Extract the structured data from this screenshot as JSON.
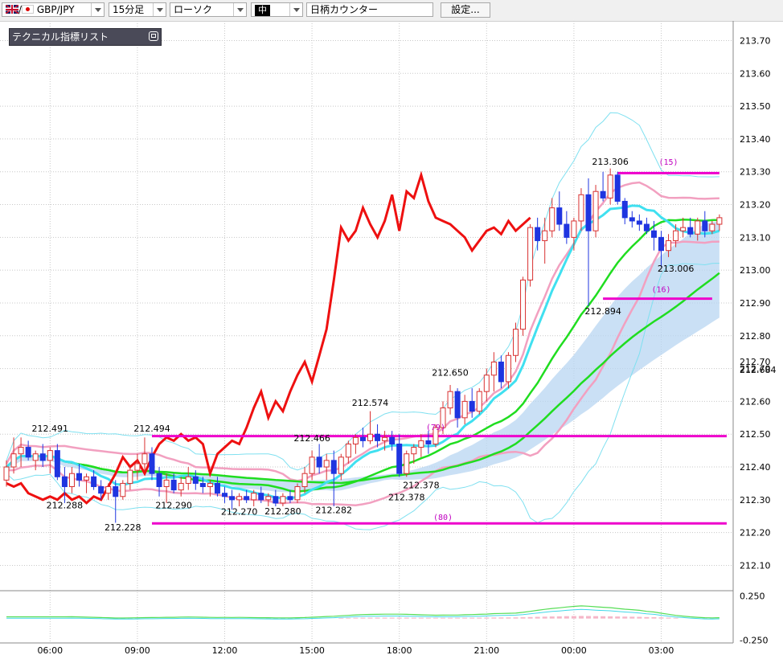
{
  "toolbar": {
    "pair": "GBP/JPY",
    "timeframe": "15分足",
    "chart_type": "ローソク",
    "draw_tool": "中",
    "counter_input": "日柄カウンター",
    "settings_label": "設定..."
  },
  "panel": {
    "title": "テクニカル指標リスト"
  },
  "colors": {
    "candle_up": "#d83030",
    "candle_down": "#1f35e0",
    "bollinger_outer": "#7fe0f0",
    "bollinger_inner": "#f2a0c0",
    "ma_fast": "#40e0f0",
    "ma_mid": "#20dd20",
    "chikou": "#ee1010",
    "lines": "#ee00cc",
    "cloud": "#b8d6f2"
  },
  "chart_data": {
    "type": "candlestick",
    "symbol": "GBP/JPY",
    "timeframe": "15分足",
    "y_ticks": [
      "213.70",
      "213.60",
      "213.50",
      "213.40",
      "213.30",
      "213.20",
      "213.10",
      "213.00",
      "212.90",
      "212.80",
      "212.70",
      "212.60",
      "212.50",
      "212.40",
      "212.30",
      "212.20",
      "212.10"
    ],
    "ylim": [
      212.035,
      213.76
    ],
    "x_labels": [
      {
        "label": "06:00",
        "bar": 6
      },
      {
        "label": "09:00",
        "bar": 18
      },
      {
        "label": "12:00",
        "bar": 30
      },
      {
        "label": "15:00",
        "bar": 42
      },
      {
        "label": "18:00",
        "bar": 54
      },
      {
        "label": "21:00",
        "bar": 66
      },
      {
        "label": "00:00",
        "bar": 78
      },
      {
        "label": "03:00",
        "bar": 90
      }
    ],
    "price_labels": [
      {
        "text": "212.491",
        "bar": 6,
        "value": 212.508
      },
      {
        "text": "212.494",
        "bar": 20,
        "value": 212.508
      },
      {
        "text": "212.288",
        "bar": 8,
        "value": 212.274
      },
      {
        "text": "212.228",
        "bar": 16,
        "value": 212.206
      },
      {
        "text": "212.290",
        "bar": 23,
        "value": 212.274
      },
      {
        "text": "212.270",
        "bar": 32,
        "value": 212.254
      },
      {
        "text": "212.280",
        "bar": 38,
        "value": 212.256
      },
      {
        "text": "212.282",
        "bar": 45,
        "value": 212.259
      },
      {
        "text": "212.466",
        "bar": 42,
        "value": 212.479
      },
      {
        "text": "212.574",
        "bar": 50,
        "value": 212.586
      },
      {
        "text": "212.378",
        "bar": 57,
        "value": 212.335
      },
      {
        "text": "212.378",
        "bar": 55,
        "value": 212.298
      },
      {
        "text": "212.650",
        "bar": 61,
        "value": 212.678
      },
      {
        "text": "213.306",
        "bar": 83,
        "value": 213.321
      },
      {
        "text": "212.894",
        "bar": 82,
        "value": 212.866
      },
      {
        "text": "213.006",
        "bar": 92,
        "value": 212.996
      }
    ],
    "count_labels": [
      {
        "text": "(15)",
        "bar": 91,
        "value": 213.321
      },
      {
        "text": "(16)",
        "bar": 90,
        "value": 212.933
      },
      {
        "text": "(79)",
        "bar": 59,
        "value": 212.513
      },
      {
        "text": "(80)",
        "bar": 60,
        "value": 212.238
      }
    ],
    "right_labels": [
      {
        "text": "212.70",
        "value": 212.721
      },
      {
        "text": "212.684",
        "value": 212.697
      }
    ],
    "hlines": [
      {
        "value": 213.296,
        "bars": [
          84,
          98
        ]
      },
      {
        "value": 212.913,
        "bars": [
          82,
          97
        ]
      },
      {
        "value": 212.494,
        "bars": [
          20,
          99
        ]
      },
      {
        "value": 212.228,
        "bars": [
          20,
          99
        ]
      }
    ],
    "candles": [
      {
        "o": 212.36,
        "h": 212.42,
        "l": 212.34,
        "c": 212.4
      },
      {
        "o": 212.4,
        "h": 212.49,
        "l": 212.38,
        "c": 212.44
      },
      {
        "o": 212.44,
        "h": 212.49,
        "l": 212.4,
        "c": 212.46
      },
      {
        "o": 212.46,
        "h": 212.48,
        "l": 212.42,
        "c": 212.43
      },
      {
        "o": 212.42,
        "h": 212.45,
        "l": 212.39,
        "c": 212.44
      },
      {
        "o": 212.44,
        "h": 212.47,
        "l": 212.4,
        "c": 212.42
      },
      {
        "o": 212.42,
        "h": 212.46,
        "l": 212.38,
        "c": 212.45
      },
      {
        "o": 212.45,
        "h": 212.47,
        "l": 212.36,
        "c": 212.37
      },
      {
        "o": 212.37,
        "h": 212.4,
        "l": 212.29,
        "c": 212.34
      },
      {
        "o": 212.34,
        "h": 212.4,
        "l": 212.32,
        "c": 212.38
      },
      {
        "o": 212.38,
        "h": 212.41,
        "l": 212.34,
        "c": 212.36
      },
      {
        "o": 212.36,
        "h": 212.38,
        "l": 212.32,
        "c": 212.37
      },
      {
        "o": 212.37,
        "h": 212.39,
        "l": 212.33,
        "c": 212.34
      },
      {
        "o": 212.34,
        "h": 212.36,
        "l": 212.3,
        "c": 212.32
      },
      {
        "o": 212.32,
        "h": 212.35,
        "l": 212.3,
        "c": 212.34
      },
      {
        "o": 212.34,
        "h": 212.36,
        "l": 212.23,
        "c": 212.31
      },
      {
        "o": 212.31,
        "h": 212.36,
        "l": 212.3,
        "c": 212.35
      },
      {
        "o": 212.35,
        "h": 212.4,
        "l": 212.33,
        "c": 212.39
      },
      {
        "o": 212.39,
        "h": 212.44,
        "l": 212.36,
        "c": 212.41
      },
      {
        "o": 212.41,
        "h": 212.49,
        "l": 212.39,
        "c": 212.44
      },
      {
        "o": 212.44,
        "h": 212.46,
        "l": 212.36,
        "c": 212.38
      },
      {
        "o": 212.38,
        "h": 212.4,
        "l": 212.31,
        "c": 212.34
      },
      {
        "o": 212.34,
        "h": 212.38,
        "l": 212.29,
        "c": 212.36
      },
      {
        "o": 212.36,
        "h": 212.38,
        "l": 212.32,
        "c": 212.33
      },
      {
        "o": 212.33,
        "h": 212.37,
        "l": 212.31,
        "c": 212.35
      },
      {
        "o": 212.35,
        "h": 212.4,
        "l": 212.33,
        "c": 212.37
      },
      {
        "o": 212.37,
        "h": 212.39,
        "l": 212.33,
        "c": 212.35
      },
      {
        "o": 212.35,
        "h": 212.37,
        "l": 212.32,
        "c": 212.34
      },
      {
        "o": 212.34,
        "h": 212.36,
        "l": 212.31,
        "c": 212.35
      },
      {
        "o": 212.35,
        "h": 212.37,
        "l": 212.31,
        "c": 212.32
      },
      {
        "o": 212.32,
        "h": 212.34,
        "l": 212.29,
        "c": 212.31
      },
      {
        "o": 212.31,
        "h": 212.33,
        "l": 212.27,
        "c": 212.3
      },
      {
        "o": 212.3,
        "h": 212.32,
        "l": 212.28,
        "c": 212.31
      },
      {
        "o": 212.31,
        "h": 212.33,
        "l": 212.29,
        "c": 212.3
      },
      {
        "o": 212.3,
        "h": 212.33,
        "l": 212.28,
        "c": 212.32
      },
      {
        "o": 212.32,
        "h": 212.34,
        "l": 212.29,
        "c": 212.3
      },
      {
        "o": 212.3,
        "h": 212.32,
        "l": 212.28,
        "c": 212.31
      },
      {
        "o": 212.31,
        "h": 212.33,
        "l": 212.28,
        "c": 212.29
      },
      {
        "o": 212.29,
        "h": 212.32,
        "l": 212.28,
        "c": 212.31
      },
      {
        "o": 212.31,
        "h": 212.33,
        "l": 212.29,
        "c": 212.3
      },
      {
        "o": 212.3,
        "h": 212.35,
        "l": 212.29,
        "c": 212.34
      },
      {
        "o": 212.34,
        "h": 212.4,
        "l": 212.32,
        "c": 212.38
      },
      {
        "o": 212.38,
        "h": 212.45,
        "l": 212.36,
        "c": 212.43
      },
      {
        "o": 212.43,
        "h": 212.47,
        "l": 212.38,
        "c": 212.4
      },
      {
        "o": 212.4,
        "h": 212.44,
        "l": 212.36,
        "c": 212.42
      },
      {
        "o": 212.42,
        "h": 212.45,
        "l": 212.28,
        "c": 212.38
      },
      {
        "o": 212.38,
        "h": 212.44,
        "l": 212.36,
        "c": 212.43
      },
      {
        "o": 212.43,
        "h": 212.48,
        "l": 212.41,
        "c": 212.47
      },
      {
        "o": 212.47,
        "h": 212.5,
        "l": 212.44,
        "c": 212.49
      },
      {
        "o": 212.49,
        "h": 212.52,
        "l": 212.46,
        "c": 212.48
      },
      {
        "o": 212.48,
        "h": 212.57,
        "l": 212.47,
        "c": 212.5
      },
      {
        "o": 212.5,
        "h": 212.53,
        "l": 212.46,
        "c": 212.48
      },
      {
        "o": 212.48,
        "h": 212.51,
        "l": 212.45,
        "c": 212.49
      },
      {
        "o": 212.49,
        "h": 212.51,
        "l": 212.45,
        "c": 212.47
      },
      {
        "o": 212.47,
        "h": 212.5,
        "l": 212.37,
        "c": 212.38
      },
      {
        "o": 212.38,
        "h": 212.45,
        "l": 212.37,
        "c": 212.44
      },
      {
        "o": 212.44,
        "h": 212.47,
        "l": 212.41,
        "c": 212.46
      },
      {
        "o": 212.46,
        "h": 212.5,
        "l": 212.43,
        "c": 212.48
      },
      {
        "o": 212.48,
        "h": 212.51,
        "l": 212.44,
        "c": 212.47
      },
      {
        "o": 212.47,
        "h": 212.53,
        "l": 212.46,
        "c": 212.52
      },
      {
        "o": 212.52,
        "h": 212.6,
        "l": 212.5,
        "c": 212.58
      },
      {
        "o": 212.58,
        "h": 212.65,
        "l": 212.56,
        "c": 212.63
      },
      {
        "o": 212.63,
        "h": 212.64,
        "l": 212.52,
        "c": 212.55
      },
      {
        "o": 212.55,
        "h": 212.62,
        "l": 212.53,
        "c": 212.6
      },
      {
        "o": 212.6,
        "h": 212.64,
        "l": 212.55,
        "c": 212.57
      },
      {
        "o": 212.57,
        "h": 212.64,
        "l": 212.56,
        "c": 212.63
      },
      {
        "o": 212.63,
        "h": 212.7,
        "l": 212.6,
        "c": 212.68
      },
      {
        "o": 212.68,
        "h": 212.75,
        "l": 212.63,
        "c": 212.72
      },
      {
        "o": 212.72,
        "h": 212.74,
        "l": 212.64,
        "c": 212.66
      },
      {
        "o": 212.66,
        "h": 212.75,
        "l": 212.64,
        "c": 212.74
      },
      {
        "o": 212.74,
        "h": 212.84,
        "l": 212.72,
        "c": 212.82
      },
      {
        "o": 212.82,
        "h": 212.98,
        "l": 212.8,
        "c": 212.97
      },
      {
        "o": 212.97,
        "h": 213.14,
        "l": 212.95,
        "c": 213.13
      },
      {
        "o": 213.13,
        "h": 213.16,
        "l": 213.06,
        "c": 213.09
      },
      {
        "o": 213.09,
        "h": 213.16,
        "l": 213.02,
        "c": 213.12
      },
      {
        "o": 213.12,
        "h": 213.22,
        "l": 213.1,
        "c": 213.19
      },
      {
        "o": 213.19,
        "h": 213.24,
        "l": 213.12,
        "c": 213.14
      },
      {
        "o": 213.14,
        "h": 213.18,
        "l": 213.08,
        "c": 213.1
      },
      {
        "o": 213.1,
        "h": 213.16,
        "l": 213.06,
        "c": 213.15
      },
      {
        "o": 213.15,
        "h": 213.25,
        "l": 213.12,
        "c": 213.23
      },
      {
        "o": 213.23,
        "h": 213.28,
        "l": 212.89,
        "c": 213.12
      },
      {
        "o": 213.12,
        "h": 213.26,
        "l": 213.1,
        "c": 213.24
      },
      {
        "o": 213.24,
        "h": 213.3,
        "l": 213.21,
        "c": 213.22
      },
      {
        "o": 213.22,
        "h": 213.31,
        "l": 213.2,
        "c": 213.29
      },
      {
        "o": 213.29,
        "h": 213.3,
        "l": 213.2,
        "c": 213.21
      },
      {
        "o": 213.21,
        "h": 213.22,
        "l": 213.14,
        "c": 213.16
      },
      {
        "o": 213.16,
        "h": 213.18,
        "l": 213.13,
        "c": 213.15
      },
      {
        "o": 213.15,
        "h": 213.17,
        "l": 213.12,
        "c": 213.14
      },
      {
        "o": 213.14,
        "h": 213.16,
        "l": 213.11,
        "c": 213.12
      },
      {
        "o": 213.12,
        "h": 213.15,
        "l": 213.06,
        "c": 213.1
      },
      {
        "o": 213.1,
        "h": 213.12,
        "l": 213.01,
        "c": 213.06
      },
      {
        "o": 213.06,
        "h": 213.11,
        "l": 213.04,
        "c": 213.09
      },
      {
        "o": 213.09,
        "h": 213.14,
        "l": 213.07,
        "c": 213.12
      },
      {
        "o": 213.12,
        "h": 213.16,
        "l": 213.1,
        "c": 213.13
      },
      {
        "o": 213.13,
        "h": 213.16,
        "l": 213.1,
        "c": 213.11
      },
      {
        "o": 213.11,
        "h": 213.16,
        "l": 213.09,
        "c": 213.15
      },
      {
        "o": 213.15,
        "h": 213.18,
        "l": 213.1,
        "c": 213.12
      },
      {
        "o": 213.12,
        "h": 213.15,
        "l": 213.11,
        "c": 213.14
      },
      {
        "o": 213.14,
        "h": 213.17,
        "l": 213.12,
        "c": 213.16
      }
    ],
    "oscillator": {
      "ticks": [
        "0.250",
        "-0.250"
      ],
      "ylim": [
        -0.28,
        0.31
      ]
    }
  }
}
